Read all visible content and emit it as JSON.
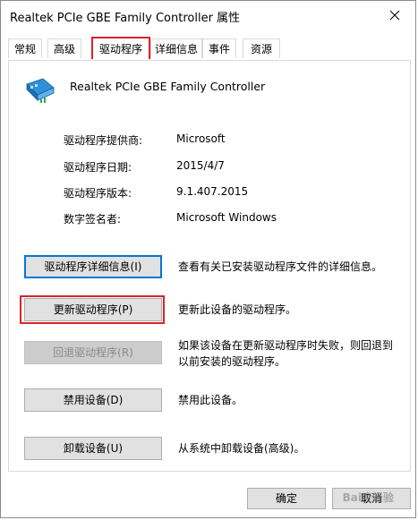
{
  "window": {
    "title": "Realtek PCIe GBE Family Controller 属性"
  },
  "tabs": [
    {
      "label": "常规"
    },
    {
      "label": "高级"
    },
    {
      "label": "驱动程序"
    },
    {
      "label": "详细信息"
    },
    {
      "label": "事件"
    },
    {
      "label": "资源"
    }
  ],
  "device": {
    "name": "Realtek PCIe GBE Family Controller",
    "icon": "network-adapter-icon"
  },
  "driver_info": [
    {
      "label": "驱动程序提供商:",
      "value": "Microsoft"
    },
    {
      "label": "驱动程序日期:",
      "value": "2015/4/7"
    },
    {
      "label": "驱动程序版本:",
      "value": "9.1.407.2015"
    },
    {
      "label": "数字签名者:",
      "value": "Microsoft Windows"
    }
  ],
  "actions": [
    {
      "label": "驱动程序详细信息(I)",
      "desc": "查看有关已安装驱动程序文件的详细信息。"
    },
    {
      "label": "更新驱动程序(P)",
      "desc": "更新此设备的驱动程序。"
    },
    {
      "label": "回退驱动程序(R)",
      "desc": "如果该设备在更新驱动程序时失败，则回退到以前安装的驱动程序。"
    },
    {
      "label": "禁用设备(D)",
      "desc": "禁用此设备。"
    },
    {
      "label": "卸载设备(U)",
      "desc": "从系统中卸载设备(高级)。"
    }
  ],
  "footer": {
    "ok_label": "确定",
    "cancel_label": "取消"
  },
  "watermark": "Bai度经验",
  "colors": {
    "highlight_red": "#d8252a",
    "focus_blue": "#0078d7"
  }
}
